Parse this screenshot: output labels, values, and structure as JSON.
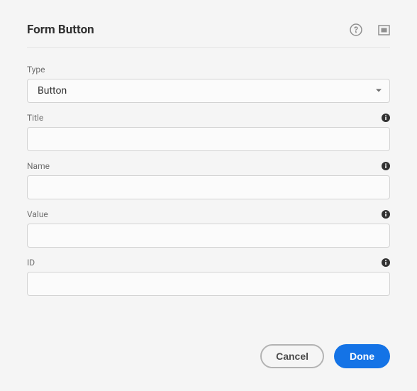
{
  "dialog": {
    "title": "Form Button"
  },
  "fields": {
    "type": {
      "label": "Type",
      "selected": "Button"
    },
    "title": {
      "label": "Title",
      "value": ""
    },
    "name": {
      "label": "Name",
      "value": ""
    },
    "value": {
      "label": "Value",
      "value": ""
    },
    "id": {
      "label": "ID",
      "value": ""
    }
  },
  "footer": {
    "cancel_label": "Cancel",
    "done_label": "Done"
  }
}
